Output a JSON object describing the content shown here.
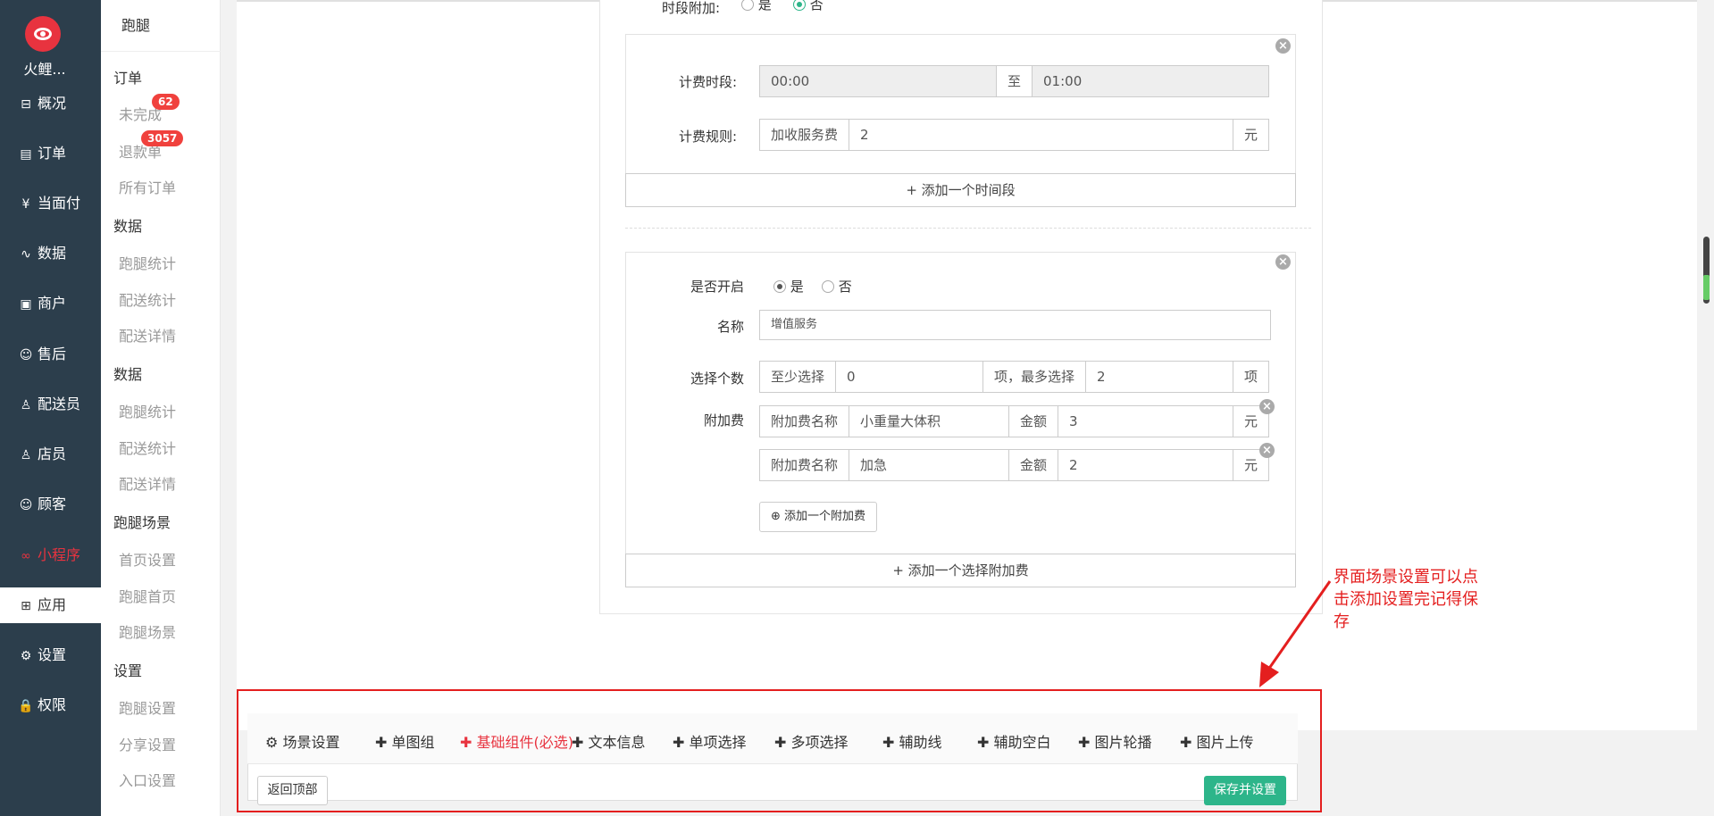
{
  "app": {
    "name": "火鲤..."
  },
  "nav": [
    {
      "icon": "overview-icon",
      "glyph": "⊟",
      "label": "概况"
    },
    {
      "icon": "order-icon",
      "glyph": "▤",
      "label": "订单"
    },
    {
      "icon": "yen-icon",
      "glyph": "¥",
      "label": "当面付"
    },
    {
      "icon": "chart-icon",
      "glyph": "∿",
      "label": "数据"
    },
    {
      "icon": "shop-icon",
      "glyph": "▣",
      "label": "商户"
    },
    {
      "icon": "aftersale-icon",
      "glyph": "☺",
      "label": "售后"
    },
    {
      "icon": "rider-icon",
      "glyph": "♙",
      "label": "配送员"
    },
    {
      "icon": "clerk-icon",
      "glyph": "♙",
      "label": "店员"
    },
    {
      "icon": "customer-icon",
      "glyph": "☺",
      "label": "顾客"
    },
    {
      "icon": "miniprogram-icon",
      "glyph": "∞",
      "label": "小程序"
    },
    {
      "icon": "app-icon",
      "glyph": "⊞",
      "label": "应用"
    },
    {
      "icon": "gear-icon",
      "glyph": "⚙",
      "label": "设置"
    },
    {
      "icon": "lock-icon",
      "glyph": "🔒",
      "label": "权限"
    }
  ],
  "subnav": {
    "title": "跑腿",
    "g1": "订单",
    "s_unfinished": "未完成",
    "badge_unfinished": "62",
    "s_refund": "退款单",
    "badge_refund": "3057",
    "s_all": "所有订单",
    "g2": "数据",
    "s_run_stats": "跑腿统计",
    "s_deliv_stats": "配送统计",
    "s_deliv_detail": "配送详情",
    "g3": "数据",
    "s_run_stats2": "跑腿统计",
    "s_deliv_stats2": "配送统计",
    "s_deliv_detail2": "配送详情",
    "g4": "跑腿场景",
    "s_home": "首页设置",
    "s_run_home": "跑腿首页",
    "s_run_scene": "跑腿场景",
    "g5": "设置",
    "s_run_set": "跑腿设置",
    "s_share": "分享设置",
    "s_entry": "入口设置"
  },
  "form": {
    "top_label": "时段附加:",
    "top_yes": "是",
    "top_no": "否",
    "period_label": "计费时段:",
    "period_start": "00:00",
    "period_to": "至",
    "period_end": "01:00",
    "rule_label": "计费规则:",
    "rule_addon": "加收服务费",
    "rule_value": "2",
    "rule_unit": "元",
    "add_period": "+ 添加一个时间段",
    "open_label": "是否开启",
    "open_yes": "是",
    "open_no": "否",
    "name_label": "名称",
    "name_value": "增值服务",
    "count_label": "选择个数",
    "count_min_addon": "至少选择",
    "count_min": "0",
    "count_mid_addon": "项，最多选择",
    "count_max": "2",
    "count_unit": "项",
    "fee_label": "附加费",
    "fees": [
      {
        "name_addon": "附加费名称",
        "name": "小重量大体积",
        "amt_addon": "金额",
        "amount": "3",
        "unit": "元"
      },
      {
        "name_addon": "附加费名称",
        "name": "加急",
        "amt_addon": "金额",
        "amount": "2",
        "unit": "元"
      }
    ],
    "add_fee_btn": "添加一个附加费",
    "add_option": "+ 添加一个选择附加费"
  },
  "toolbar": {
    "items": [
      {
        "label": "场景设置",
        "prefix": "⚙ "
      },
      {
        "label": "单图组",
        "prefix": "✚ "
      },
      {
        "label": "基础组件(必选)",
        "prefix": "✚ "
      },
      {
        "label": "文本信息",
        "prefix": "✚ "
      },
      {
        "label": "单项选择",
        "prefix": "✚ "
      },
      {
        "label": "多项选择",
        "prefix": "✚ "
      },
      {
        "label": "辅助线",
        "prefix": "✚ "
      },
      {
        "label": "辅助空白",
        "prefix": "✚ "
      },
      {
        "label": "图片轮播",
        "prefix": "✚ "
      },
      {
        "label": "图片上传",
        "prefix": "✚ "
      }
    ],
    "back_top": "返回顶部",
    "save": "保存并设置"
  },
  "annotation": "界面场景设置可以点击添加设置完记得保存",
  "colors": {
    "accent": "#e8333f",
    "save": "#2db58a",
    "annotation": "#e41f1f",
    "sidebar": "#2c3e4c"
  }
}
